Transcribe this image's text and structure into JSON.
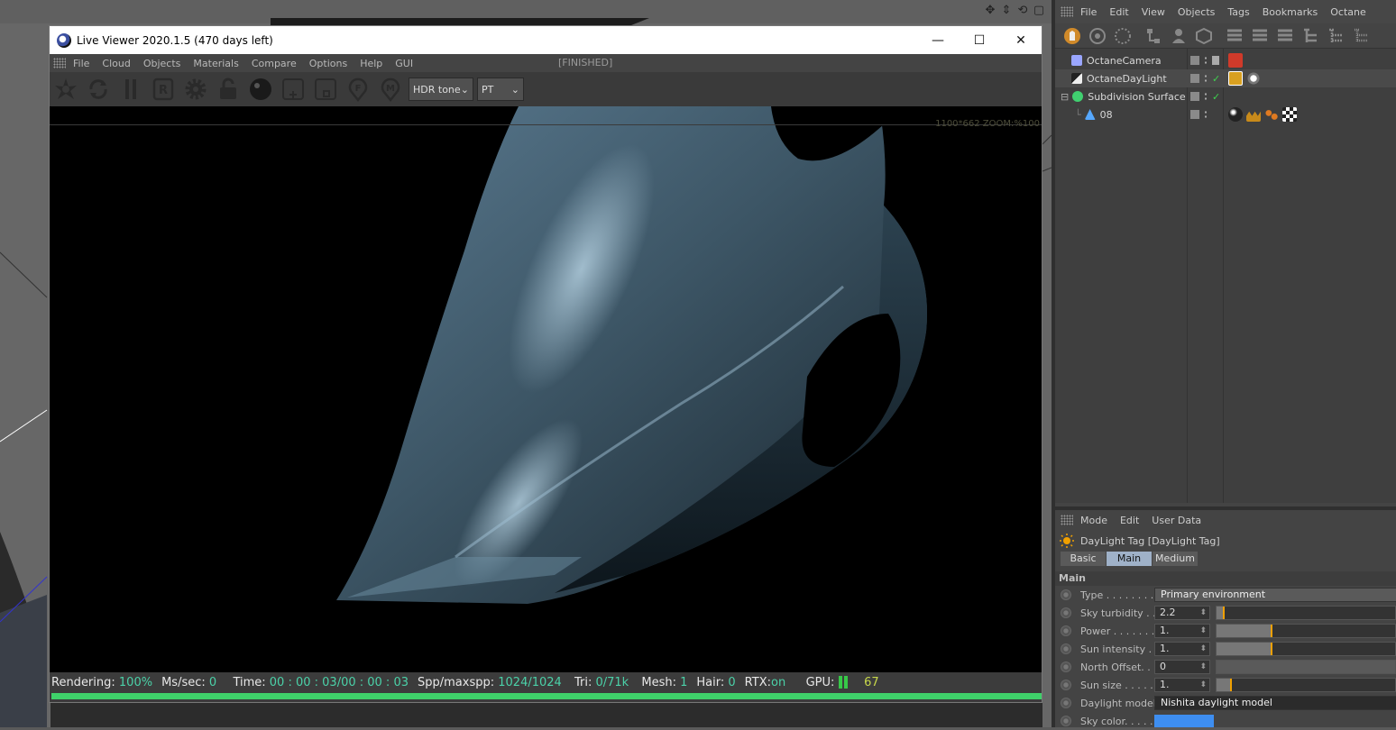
{
  "live_viewer": {
    "title": "Live Viewer 2020.1.5 (470 days left)",
    "menu": [
      "File",
      "Cloud",
      "Objects",
      "Materials",
      "Compare",
      "Options",
      "Help",
      "GUI"
    ],
    "render_state": "[FINISHED]",
    "tone_select": "HDR tone",
    "kernel_select": "PT",
    "zoom_readout": "1100*662 ZOOM:%100",
    "status": {
      "rendering_label": "Rendering:",
      "rendering_value": "100%",
      "mssec_label": "Ms/sec:",
      "mssec_value": "0",
      "time_label": "Time:",
      "time_value": "00 : 00 : 03/00 : 00 : 03",
      "spp_label": "Spp/maxspp:",
      "spp_value": "1024/1024",
      "tri_label": "Tri:",
      "tri_value": "0/71k",
      "mesh_label": "Mesh:",
      "mesh_value": "1",
      "hair_label": "Hair:",
      "hair_value": "0",
      "rtx_label": "RTX:",
      "rtx_value": "on",
      "gpu_label": "GPU:",
      "gpu_value": "67"
    },
    "progress": 1.0
  },
  "object_manager": {
    "menu": [
      "File",
      "Edit",
      "View",
      "Objects",
      "Tags",
      "Bookmarks",
      "Octane"
    ],
    "objects": [
      {
        "name": "OctaneCamera",
        "indent": 0,
        "icon_color": "#9aa6ff"
      },
      {
        "name": "OctaneDayLight",
        "indent": 0,
        "icon_color": "#dddddd"
      },
      {
        "name": "Subdivision Surface",
        "indent": 0,
        "icon_color": "#40d070"
      },
      {
        "name": "08",
        "indent": 1,
        "icon_color": "#56a8ff"
      }
    ]
  },
  "attribute_manager": {
    "menu": [
      "Mode",
      "Edit",
      "User Data"
    ],
    "title": "DayLight Tag [DayLight Tag]",
    "tabs": [
      "Basic",
      "Main",
      "Medium"
    ],
    "active_tab": "Main",
    "section": "Main",
    "fields": {
      "type_label": "Type . . . . . . . .",
      "type_value": "Primary environment",
      "turbidity_label": "Sky turbidity . .",
      "turbidity_value": "2.2",
      "turbidity_level": 0.04,
      "power_label": "Power . . . . . . .",
      "power_value": "1.",
      "power_level": 0.31,
      "sun_intensity_label": "Sun intensity . .",
      "sun_intensity_value": "1.",
      "sun_intensity_level": 0.31,
      "north_offset_label": "North Offset. . .",
      "north_offset_value": "0",
      "sun_size_label": "Sun size . . . . .",
      "sun_size_value": "1.",
      "sun_size_level": 0.08,
      "daylight_model_label": "Daylight model",
      "daylight_model_value": "Nishita daylight model",
      "sky_color_label": "Sky color. . . . .",
      "sky_color": "#3e8ef0"
    }
  }
}
